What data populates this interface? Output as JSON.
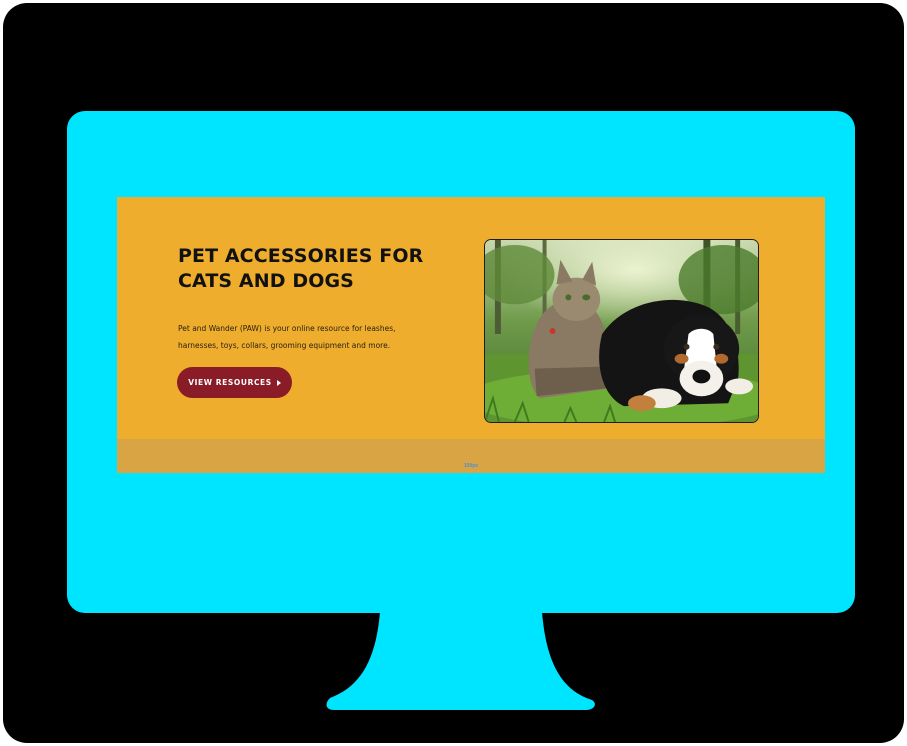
{
  "hero": {
    "headline_line1": "PET ACCESSORIES FOR",
    "headline_line2": "CATS AND DOGS",
    "subtext_line1": "Pet and Wander (PAW) is your online resource for leashes,",
    "subtext_line2": "harnesses, toys, collars, grooming equipment and more.",
    "cta_label": "VIEW RESOURCES",
    "photo_icon": "cat-and-dog-photo",
    "strip_label": "100px"
  },
  "colors": {
    "monitor_frame": "#000000",
    "screen": "#00e5ff",
    "hero_background": "#eead2d",
    "hero_strip": "#d8a444",
    "cta_background": "#8a1c28",
    "headline_text": "#111111"
  }
}
